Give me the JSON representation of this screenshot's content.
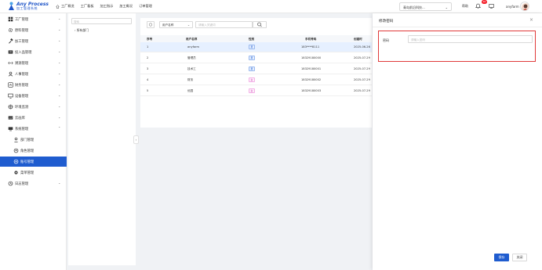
{
  "app": {
    "brand_title": "Any Process",
    "brand_subtitle": "加工管理系统"
  },
  "topnav": [
    {
      "label": "工厂概览",
      "icon": "home-icon"
    },
    {
      "label": "工厂看板"
    },
    {
      "label": "加工指示"
    },
    {
      "label": "加工概况"
    },
    {
      "label": "订单管理"
    }
  ],
  "header": {
    "factory_select": "青岛前沿科技...",
    "help": "帮助",
    "badge": "10",
    "user": "anyfarm"
  },
  "sidebar": {
    "items": [
      {
        "label": "工厂管理",
        "icon": "grid-icon"
      },
      {
        "label": "原料管理",
        "icon": "gear-icon"
      },
      {
        "label": "加工管理",
        "icon": "hammer-icon"
      },
      {
        "label": "投入品管理",
        "icon": "box-icon"
      },
      {
        "label": "溯源管理",
        "icon": "link-icon"
      },
      {
        "label": "人事管理",
        "icon": "person-icon"
      },
      {
        "label": "财务管理",
        "icon": "finance-icon"
      },
      {
        "label": "设备管理",
        "icon": "monitor-icon"
      },
      {
        "label": "环境监测",
        "icon": "env-icon"
      },
      {
        "label": "云画库",
        "icon": "image-icon"
      },
      {
        "label": "系统管理",
        "icon": "system-icon"
      },
      {
        "label": "部门管理",
        "icon": "user-outline-icon"
      },
      {
        "label": "角色管理",
        "icon": "role-icon"
      },
      {
        "label": "账号管理",
        "icon": "account-icon"
      },
      {
        "label": "菜单管理",
        "icon": "menu-gear-icon"
      },
      {
        "label": "日志管理",
        "icon": "log-icon"
      }
    ]
  },
  "dept_tree": {
    "search_placeholder": "搜索",
    "root": "所有部门"
  },
  "filter": {
    "field": "用户名称",
    "keyword_placeholder": "请输入关键词"
  },
  "table": {
    "headers": [
      "序号",
      "用户名称",
      "性别",
      "手机号码",
      "创建时"
    ],
    "rows": [
      {
        "idx": "1",
        "name": "anyfarm",
        "gender": "男",
        "phone": "183****8111",
        "created": "2025-06-26"
      },
      {
        "idx": "2",
        "name": "管理员",
        "gender": "男",
        "phone": "18329180000",
        "created": "2025-07-29"
      },
      {
        "idx": "3",
        "name": "技术工",
        "gender": "男",
        "phone": "18329180001",
        "created": "2025-07-29"
      },
      {
        "idx": "4",
        "name": "财务",
        "gender": "女",
        "phone": "18329180002",
        "created": "2025-07-29"
      },
      {
        "idx": "5",
        "name": "优园",
        "gender": "女",
        "phone": "18329180003",
        "created": "2025-07-29"
      }
    ]
  },
  "drawer": {
    "title": "修改密码",
    "password_label": "密码",
    "password_placeholder": "请输入密码",
    "save": "保存",
    "close": "关闭"
  },
  "colors": {
    "primary": "#1f5ccf",
    "highlight": "#e03a3a",
    "badge": "#f5222d"
  }
}
